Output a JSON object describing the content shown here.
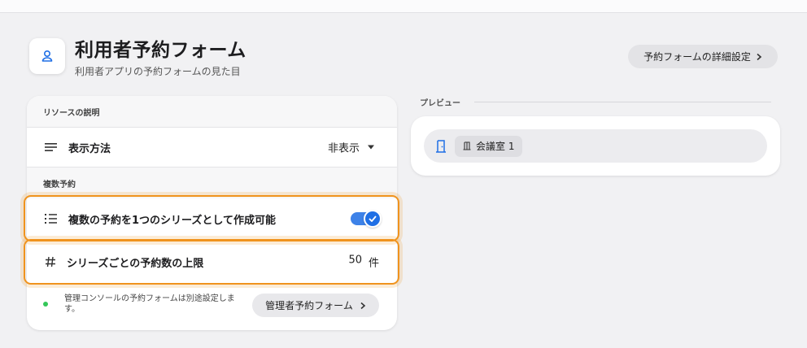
{
  "header": {
    "title": "利用者予約フォーム",
    "subtitle": "利用者アプリの予約フォームの見た目",
    "detail_button_label": "予約フォームの詳細設定"
  },
  "sections": {
    "resource_description": {
      "heading": "リソースの説明",
      "display_method_label": "表示方法",
      "display_method_value": "非表示"
    },
    "multiple_reservations": {
      "heading": "複数予約",
      "series_toggle_label": "複数の予約を1つのシリーズとして作成可能",
      "series_toggle_on": true,
      "limit_label": "シリーズごとの予約数の上限",
      "limit_value": "50",
      "limit_unit": "件"
    }
  },
  "footer": {
    "note": "管理コンソールの予約フォームは別途設定します。",
    "admin_button_label": "管理者予約フォーム"
  },
  "preview": {
    "label": "プレビュー",
    "room_label": "会議室 1"
  },
  "colors": {
    "accent": "#1f6fe5",
    "highlight": "#f0931d",
    "status_dot": "#34c759"
  }
}
